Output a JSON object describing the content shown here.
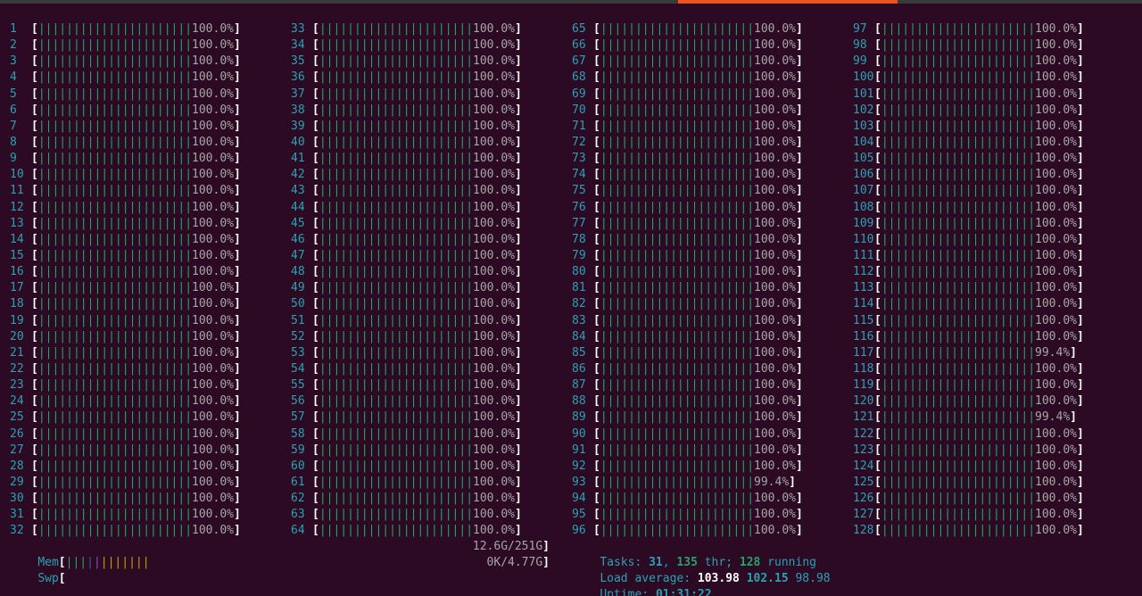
{
  "window": {
    "chrome": {
      "accent_color": "#e95420",
      "background_color": "#2c0a23"
    }
  },
  "cpu_meters": {
    "columns": [
      [
        {
          "id": "1",
          "bar": "||||||||||||||||||||||",
          "percent": "100.0%"
        },
        {
          "id": "2",
          "bar": "||||||||||||||||||||||",
          "percent": "100.0%"
        },
        {
          "id": "3",
          "bar": "||||||||||||||||||||||",
          "percent": "100.0%"
        },
        {
          "id": "4",
          "bar": "||||||||||||||||||||||",
          "percent": "100.0%"
        },
        {
          "id": "5",
          "bar": "||||||||||||||||||||||",
          "percent": "100.0%"
        },
        {
          "id": "6",
          "bar": "||||||||||||||||||||||",
          "percent": "100.0%"
        },
        {
          "id": "7",
          "bar": "||||||||||||||||||||||",
          "percent": "100.0%"
        },
        {
          "id": "8",
          "bar": "||||||||||||||||||||||",
          "percent": "100.0%"
        },
        {
          "id": "9",
          "bar": "||||||||||||||||||||||",
          "percent": "100.0%"
        },
        {
          "id": "10",
          "bar": "||||||||||||||||||||||",
          "percent": "100.0%"
        },
        {
          "id": "11",
          "bar": "||||||||||||||||||||||",
          "percent": "100.0%"
        },
        {
          "id": "12",
          "bar": "||||||||||||||||||||||",
          "percent": "100.0%"
        },
        {
          "id": "13",
          "bar": "||||||||||||||||||||||",
          "percent": "100.0%"
        },
        {
          "id": "14",
          "bar": "||||||||||||||||||||||",
          "percent": "100.0%"
        },
        {
          "id": "15",
          "bar": "||||||||||||||||||||||",
          "percent": "100.0%"
        },
        {
          "id": "16",
          "bar": "||||||||||||||||||||||",
          "percent": "100.0%"
        },
        {
          "id": "17",
          "bar": "||||||||||||||||||||||",
          "percent": "100.0%"
        },
        {
          "id": "18",
          "bar": "||||||||||||||||||||||",
          "percent": "100.0%"
        },
        {
          "id": "19",
          "bar": "||||||||||||||||||||||",
          "percent": "100.0%"
        },
        {
          "id": "20",
          "bar": "||||||||||||||||||||||",
          "percent": "100.0%"
        },
        {
          "id": "21",
          "bar": "||||||||||||||||||||||",
          "percent": "100.0%"
        },
        {
          "id": "22",
          "bar": "||||||||||||||||||||||",
          "percent": "100.0%"
        },
        {
          "id": "23",
          "bar": "||||||||||||||||||||||",
          "percent": "100.0%"
        },
        {
          "id": "24",
          "bar": "||||||||||||||||||||||",
          "percent": "100.0%"
        },
        {
          "id": "25",
          "bar": "||||||||||||||||||||||",
          "percent": "100.0%"
        },
        {
          "id": "26",
          "bar": "||||||||||||||||||||||",
          "percent": "100.0%"
        },
        {
          "id": "27",
          "bar": "||||||||||||||||||||||",
          "percent": "100.0%"
        },
        {
          "id": "28",
          "bar": "||||||||||||||||||||||",
          "percent": "100.0%"
        },
        {
          "id": "29",
          "bar": "||||||||||||||||||||||",
          "percent": "100.0%"
        },
        {
          "id": "30",
          "bar": "||||||||||||||||||||||",
          "percent": "100.0%"
        },
        {
          "id": "31",
          "bar": "||||||||||||||||||||||",
          "percent": "100.0%"
        },
        {
          "id": "32",
          "bar": "||||||||||||||||||||||",
          "percent": "100.0%"
        }
      ],
      [
        {
          "id": "33",
          "bar": "||||||||||||||||||||||",
          "percent": "100.0%"
        },
        {
          "id": "34",
          "bar": "||||||||||||||||||||||",
          "percent": "100.0%"
        },
        {
          "id": "35",
          "bar": "||||||||||||||||||||||",
          "percent": "100.0%"
        },
        {
          "id": "36",
          "bar": "||||||||||||||||||||||",
          "percent": "100.0%"
        },
        {
          "id": "37",
          "bar": "||||||||||||||||||||||",
          "percent": "100.0%"
        },
        {
          "id": "38",
          "bar": "||||||||||||||||||||||",
          "percent": "100.0%"
        },
        {
          "id": "39",
          "bar": "||||||||||||||||||||||",
          "percent": "100.0%"
        },
        {
          "id": "40",
          "bar": "||||||||||||||||||||||",
          "percent": "100.0%"
        },
        {
          "id": "41",
          "bar": "||||||||||||||||||||||",
          "percent": "100.0%"
        },
        {
          "id": "42",
          "bar": "||||||||||||||||||||||",
          "percent": "100.0%"
        },
        {
          "id": "43",
          "bar": "||||||||||||||||||||||",
          "percent": "100.0%"
        },
        {
          "id": "44",
          "bar": "||||||||||||||||||||||",
          "percent": "100.0%"
        },
        {
          "id": "45",
          "bar": "||||||||||||||||||||||",
          "percent": "100.0%"
        },
        {
          "id": "46",
          "bar": "||||||||||||||||||||||",
          "percent": "100.0%"
        },
        {
          "id": "47",
          "bar": "||||||||||||||||||||||",
          "percent": "100.0%"
        },
        {
          "id": "48",
          "bar": "||||||||||||||||||||||",
          "percent": "100.0%"
        },
        {
          "id": "49",
          "bar": "||||||||||||||||||||||",
          "percent": "100.0%"
        },
        {
          "id": "50",
          "bar": "||||||||||||||||||||||",
          "percent": "100.0%"
        },
        {
          "id": "51",
          "bar": "||||||||||||||||||||||",
          "percent": "100.0%"
        },
        {
          "id": "52",
          "bar": "||||||||||||||||||||||",
          "percent": "100.0%"
        },
        {
          "id": "53",
          "bar": "||||||||||||||||||||||",
          "percent": "100.0%"
        },
        {
          "id": "54",
          "bar": "||||||||||||||||||||||",
          "percent": "100.0%"
        },
        {
          "id": "55",
          "bar": "||||||||||||||||||||||",
          "percent": "100.0%"
        },
        {
          "id": "56",
          "bar": "||||||||||||||||||||||",
          "percent": "100.0%"
        },
        {
          "id": "57",
          "bar": "||||||||||||||||||||||",
          "percent": "100.0%"
        },
        {
          "id": "58",
          "bar": "||||||||||||||||||||||",
          "percent": "100.0%"
        },
        {
          "id": "59",
          "bar": "||||||||||||||||||||||",
          "percent": "100.0%"
        },
        {
          "id": "60",
          "bar": "||||||||||||||||||||||",
          "percent": "100.0%"
        },
        {
          "id": "61",
          "bar": "||||||||||||||||||||||",
          "percent": "100.0%"
        },
        {
          "id": "62",
          "bar": "||||||||||||||||||||||",
          "percent": "100.0%"
        },
        {
          "id": "63",
          "bar": "||||||||||||||||||||||",
          "percent": "100.0%"
        },
        {
          "id": "64",
          "bar": "||||||||||||||||||||||",
          "percent": "100.0%"
        }
      ],
      [
        {
          "id": "65",
          "bar": "||||||||||||||||||||||",
          "percent": "100.0%"
        },
        {
          "id": "66",
          "bar": "||||||||||||||||||||||",
          "percent": "100.0%"
        },
        {
          "id": "67",
          "bar": "||||||||||||||||||||||",
          "percent": "100.0%"
        },
        {
          "id": "68",
          "bar": "||||||||||||||||||||||",
          "percent": "100.0%"
        },
        {
          "id": "69",
          "bar": "||||||||||||||||||||||",
          "percent": "100.0%"
        },
        {
          "id": "70",
          "bar": "||||||||||||||||||||||",
          "percent": "100.0%"
        },
        {
          "id": "71",
          "bar": "||||||||||||||||||||||",
          "percent": "100.0%"
        },
        {
          "id": "72",
          "bar": "||||||||||||||||||||||",
          "percent": "100.0%"
        },
        {
          "id": "73",
          "bar": "||||||||||||||||||||||",
          "percent": "100.0%"
        },
        {
          "id": "74",
          "bar": "||||||||||||||||||||||",
          "percent": "100.0%"
        },
        {
          "id": "75",
          "bar": "||||||||||||||||||||||",
          "percent": "100.0%"
        },
        {
          "id": "76",
          "bar": "||||||||||||||||||||||",
          "percent": "100.0%"
        },
        {
          "id": "77",
          "bar": "||||||||||||||||||||||",
          "percent": "100.0%"
        },
        {
          "id": "78",
          "bar": "||||||||||||||||||||||",
          "percent": "100.0%"
        },
        {
          "id": "79",
          "bar": "||||||||||||||||||||||",
          "percent": "100.0%"
        },
        {
          "id": "80",
          "bar": "||||||||||||||||||||||",
          "percent": "100.0%"
        },
        {
          "id": "81",
          "bar": "||||||||||||||||||||||",
          "percent": "100.0%"
        },
        {
          "id": "82",
          "bar": "||||||||||||||||||||||",
          "percent": "100.0%"
        },
        {
          "id": "83",
          "bar": "||||||||||||||||||||||",
          "percent": "100.0%"
        },
        {
          "id": "84",
          "bar": "||||||||||||||||||||||",
          "percent": "100.0%"
        },
        {
          "id": "85",
          "bar": "||||||||||||||||||||||",
          "percent": "100.0%"
        },
        {
          "id": "86",
          "bar": "||||||||||||||||||||||",
          "percent": "100.0%"
        },
        {
          "id": "87",
          "bar": "||||||||||||||||||||||",
          "percent": "100.0%"
        },
        {
          "id": "88",
          "bar": "||||||||||||||||||||||",
          "percent": "100.0%"
        },
        {
          "id": "89",
          "bar": "||||||||||||||||||||||",
          "percent": "100.0%"
        },
        {
          "id": "90",
          "bar": "||||||||||||||||||||||",
          "percent": "100.0%"
        },
        {
          "id": "91",
          "bar": "||||||||||||||||||||||",
          "percent": "100.0%"
        },
        {
          "id": "92",
          "bar": "||||||||||||||||||||||",
          "percent": "100.0%"
        },
        {
          "id": "93",
          "bar": "||||||||||||||||||||||",
          "percent": "99.4%"
        },
        {
          "id": "94",
          "bar": "||||||||||||||||||||||",
          "percent": "100.0%"
        },
        {
          "id": "95",
          "bar": "||||||||||||||||||||||",
          "percent": "100.0%"
        },
        {
          "id": "96",
          "bar": "||||||||||||||||||||||",
          "percent": "100.0%"
        }
      ],
      [
        {
          "id": "97",
          "bar": "||||||||||||||||||||||",
          "percent": "100.0%"
        },
        {
          "id": "98",
          "bar": "||||||||||||||||||||||",
          "percent": "100.0%"
        },
        {
          "id": "99",
          "bar": "||||||||||||||||||||||",
          "percent": "100.0%"
        },
        {
          "id": "100",
          "bar": "||||||||||||||||||||||",
          "percent": "100.0%"
        },
        {
          "id": "101",
          "bar": "||||||||||||||||||||||",
          "percent": "100.0%"
        },
        {
          "id": "102",
          "bar": "||||||||||||||||||||||",
          "percent": "100.0%"
        },
        {
          "id": "103",
          "bar": "||||||||||||||||||||||",
          "percent": "100.0%"
        },
        {
          "id": "104",
          "bar": "||||||||||||||||||||||",
          "percent": "100.0%"
        },
        {
          "id": "105",
          "bar": "||||||||||||||||||||||",
          "percent": "100.0%"
        },
        {
          "id": "106",
          "bar": "||||||||||||||||||||||",
          "percent": "100.0%"
        },
        {
          "id": "107",
          "bar": "||||||||||||||||||||||",
          "percent": "100.0%"
        },
        {
          "id": "108",
          "bar": "||||||||||||||||||||||",
          "percent": "100.0%"
        },
        {
          "id": "109",
          "bar": "||||||||||||||||||||||",
          "percent": "100.0%"
        },
        {
          "id": "110",
          "bar": "||||||||||||||||||||||",
          "percent": "100.0%"
        },
        {
          "id": "111",
          "bar": "||||||||||||||||||||||",
          "percent": "100.0%"
        },
        {
          "id": "112",
          "bar": "||||||||||||||||||||||",
          "percent": "100.0%"
        },
        {
          "id": "113",
          "bar": "||||||||||||||||||||||",
          "percent": "100.0%"
        },
        {
          "id": "114",
          "bar": "||||||||||||||||||||||",
          "percent": "100.0%"
        },
        {
          "id": "115",
          "bar": "||||||||||||||||||||||",
          "percent": "100.0%"
        },
        {
          "id": "116",
          "bar": "||||||||||||||||||||||",
          "percent": "100.0%"
        },
        {
          "id": "117",
          "bar": "||||||||||||||||||||||",
          "percent": "99.4%"
        },
        {
          "id": "118",
          "bar": "||||||||||||||||||||||",
          "percent": "100.0%"
        },
        {
          "id": "119",
          "bar": "||||||||||||||||||||||",
          "percent": "100.0%"
        },
        {
          "id": "120",
          "bar": "||||||||||||||||||||||",
          "percent": "100.0%"
        },
        {
          "id": "121",
          "bar": "||||||||||||||||||||||",
          "percent": "99.4%"
        },
        {
          "id": "122",
          "bar": "||||||||||||||||||||||",
          "percent": "100.0%"
        },
        {
          "id": "123",
          "bar": "||||||||||||||||||||||",
          "percent": "100.0%"
        },
        {
          "id": "124",
          "bar": "||||||||||||||||||||||",
          "percent": "100.0%"
        },
        {
          "id": "125",
          "bar": "||||||||||||||||||||||",
          "percent": "100.0%"
        },
        {
          "id": "126",
          "bar": "||||||||||||||||||||||",
          "percent": "100.0%"
        },
        {
          "id": "127",
          "bar": "||||||||||||||||||||||",
          "percent": "100.0%"
        },
        {
          "id": "128",
          "bar": "||||||||||||||||||||||",
          "percent": "100.0%"
        }
      ]
    ]
  },
  "memory": {
    "mem_label": "Mem",
    "mem_value": "12.6G/251G",
    "swp_label": "Swp",
    "swp_value": "0K/4.77G",
    "open_bracket": "[",
    "close_bracket": "]",
    "mem_bar": {
      "green": "|||",
      "blue": "|",
      "purple": "|",
      "orange": "|||||||"
    }
  },
  "tasks": {
    "label": "Tasks: ",
    "count": "31",
    "sep1": ", ",
    "threads": "135",
    "thr_label": " thr",
    "sep2": "; ",
    "running": "128",
    "running_label": " running"
  },
  "load": {
    "label": "Load average: ",
    "avg1": "103.98",
    "avg5": "102.15",
    "avg15": "98.98"
  },
  "uptime": {
    "label": "Uptime: ",
    "value": "01:31:22"
  }
}
